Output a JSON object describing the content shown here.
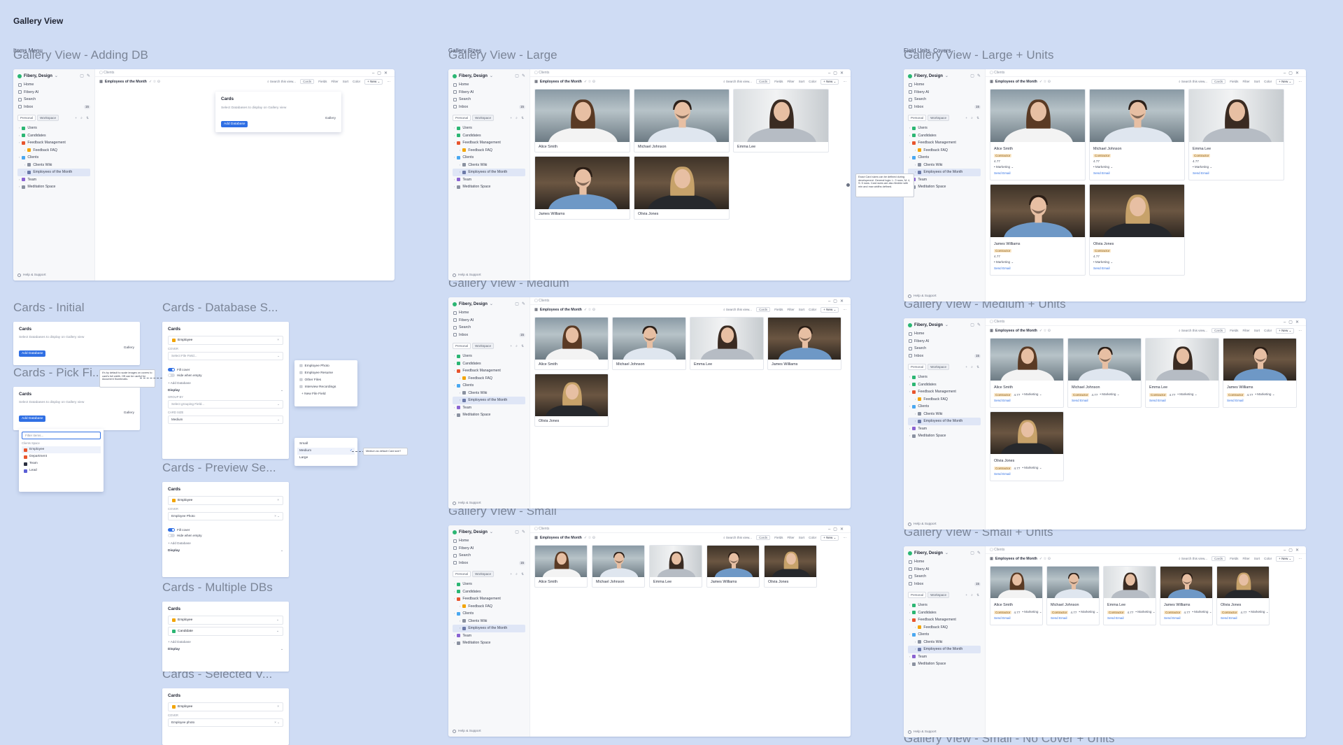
{
  "page_title": "Gallery View",
  "frames": {
    "adding_db": {
      "title": "Gallery View - Adding DB",
      "small": "Items Menu"
    },
    "large": {
      "title": "Gallery View - Large",
      "small": "Gallery Sizes"
    },
    "large_units": {
      "title": "Gallery View - Large + Units",
      "small": "Field Units, Covers"
    },
    "medium": {
      "title": "Gallery View - Medium"
    },
    "medium_units": {
      "title": "Gallery View - Medium + Units"
    },
    "small": {
      "title": "Gallery View - Small"
    },
    "small_units": {
      "title": "Gallery View - Small + Units"
    },
    "small_nocover": {
      "title": "Gallery View - Small - No Cover + Units"
    },
    "cards_initial": {
      "title": "Cards - Initial"
    },
    "cards_db_select": {
      "title": "Cards - Database S..."
    },
    "cards_pick": {
      "title": "Cards - Pick Fi..."
    },
    "cards_preview": {
      "title": "Cards - Preview Se..."
    },
    "cards_multi": {
      "title": "Cards - Multiple DBs"
    },
    "cards_selected": {
      "title": "Cards - Selected V..."
    }
  },
  "app": {
    "workspace": "Fibery, Design",
    "nav": [
      "Home",
      "Fibery AI",
      "Search",
      "Inbox"
    ],
    "inbox_count": "15",
    "tabs": [
      "Personal",
      "Workspace"
    ],
    "tree": [
      {
        "label": "Users",
        "color": "#2bb673",
        "indent": 0
      },
      {
        "label": "Candidates",
        "color": "#2bb673",
        "indent": 0
      },
      {
        "label": "Feedback Management",
        "color": "#e8552e",
        "indent": 0
      },
      {
        "label": "Feedback FAQ",
        "color": "#f2a400",
        "indent": 1
      },
      {
        "label": "Clients",
        "color": "#4aa8f0",
        "indent": 0
      },
      {
        "label": "Clients Wiki",
        "color": "#8a91a0",
        "indent": 1
      },
      {
        "label": "Employees of the Month",
        "color": "#6c7aa8",
        "indent": 1
      },
      {
        "label": "Team",
        "color": "#8a63d2",
        "indent": 0
      },
      {
        "label": "Meditation Space",
        "color": "#8a91a0",
        "indent": 0
      }
    ],
    "help": "Help & Support",
    "crumb": "Clients",
    "view_title": "Employees of the Month",
    "search_placeholder": "Search this view...",
    "tools": [
      "Cards",
      "Fields",
      "Filter",
      "Sort",
      "Color"
    ],
    "new_label": "New"
  },
  "people": [
    {
      "name": "Alice Smith",
      "bg": "office",
      "hair": "#5a3a24",
      "shirt": "#f3f3f3",
      "fem": true
    },
    {
      "name": "Michael Johnson",
      "bg": "office",
      "hair": "#2c2019",
      "shirt": "#dfe6ef",
      "fem": false
    },
    {
      "name": "Emma Lee",
      "bg": "bright",
      "hair": "#3a2b22",
      "shirt": "#b6bcc4",
      "fem": true
    },
    {
      "name": "James Williams",
      "bg": "cafe",
      "hair": "#2b1e16",
      "shirt": "#6e98c6",
      "fem": false
    },
    {
      "name": "Olivia Jones",
      "bg": "cafe",
      "hair": "#c7a26a",
      "shirt": "#26282c",
      "fem": true
    }
  ],
  "units": {
    "role": "Contractor",
    "rating": "4.77",
    "dept": "Marketing",
    "action": "Send Email"
  },
  "cards_panel": {
    "heading": "Cards",
    "hint": "Select Databases to display on Gallery view",
    "add_db": "Add Database",
    "gallery": "Gallery",
    "filter_placeholder": "Filter items...",
    "space_label": "Clients Space",
    "db_options": [
      "Employee",
      "Department",
      "Team",
      "Lead"
    ],
    "cover_label": "COVER",
    "cover_placeholder": "Select File Field...",
    "fill_cover": "Fill cover",
    "hide_empty": "Hide when empty",
    "add_database_link": "+ Add Database",
    "display": "Display",
    "group_by": "GROUP BY",
    "group_placeholder": "Select grouping Field...",
    "card_size": "CARD SIZE",
    "size_value": "Medium",
    "sizes": [
      "Small",
      "Medium",
      "Large"
    ],
    "file_fields": [
      "Employee Photo",
      "Employee Resume",
      "Other Files",
      "Interview Recordings",
      "+ New File Field"
    ],
    "employee_photo": "Employee Photo",
    "employee_photo_lc": "Employee photo",
    "db_employee": "Employee",
    "db_candidate": "Candidate"
  },
  "notes": {
    "cover_tip": "It's by default to scale images on covers to card's full width. Off can be useful for document thumbnails.",
    "size_tip": "Medium as default Card size?",
    "units_tip": "Exact Card sizes can be defined during development. General logic: L: 3 rows, M: 4, S: 5 rows. Card sizes are also flexible with min and max widths defined."
  },
  "colors": {
    "canvas": "#cfdcf4",
    "accent": "#2f6fe4",
    "title": "#7b8597"
  }
}
